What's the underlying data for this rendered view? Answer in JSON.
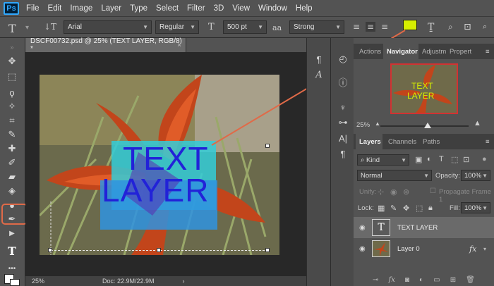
{
  "app": {
    "logo": "Ps"
  },
  "menu": [
    "File",
    "Edit",
    "Image",
    "Layer",
    "Type",
    "Select",
    "Filter",
    "3D",
    "View",
    "Window",
    "Help"
  ],
  "options": {
    "font_family": "Arial",
    "font_style": "Regular",
    "font_size": "500 pt",
    "aa_label": "a",
    "antialias": "Strong",
    "text_color": "#d6ef00"
  },
  "document": {
    "tab_title": "DSCF00732.psd @ 25% (TEXT LAYER, RGB/8) *",
    "close": "×",
    "text_line1": "TEXT",
    "text_line2": "LAYER",
    "text_color": "#2222d8"
  },
  "status": {
    "zoom": "25%",
    "doc": "Doc: 22.9M/22.9M",
    "arrow": "›"
  },
  "panels": {
    "top_tabs": [
      "Actions",
      "Navigator",
      "Adjustm",
      "Propert"
    ],
    "nav_zoom": "25%",
    "layer_tabs": [
      "Layers",
      "Channels",
      "Paths"
    ],
    "filter_kind": "Kind",
    "blend_mode": "Normal",
    "opacity_label": "Opacity:",
    "opacity": "100%",
    "unify_label": "Unify:",
    "propagate_label": "Propagate Frame 1",
    "lock_label": "Lock:",
    "fill_label": "Fill:",
    "fill": "100%",
    "layers": [
      {
        "name": "TEXT LAYER",
        "selected": true
      },
      {
        "name": "Layer 0",
        "selected": false,
        "fx": "fx"
      }
    ]
  },
  "colors": {
    "accent_highlight": "#e06a48",
    "nav_frame": "#d23232"
  }
}
